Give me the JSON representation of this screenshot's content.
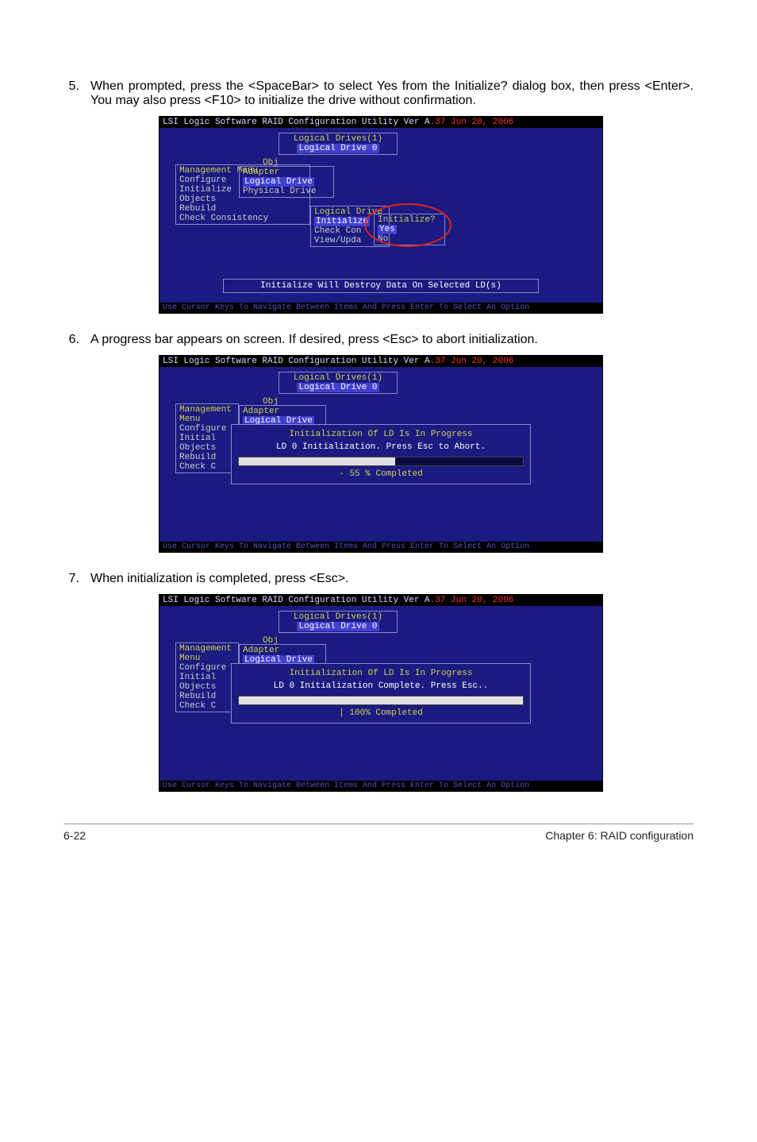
{
  "steps": {
    "s5": {
      "num": "5.",
      "text": "When prompted, press the <SpaceBar> to select Yes from the Initialize? dialog box, then press <Enter>. You may also press <F10> to initialize the drive without confirmation."
    },
    "s6": {
      "num": "6.",
      "text": "A progress bar appears on screen. If desired, press <Esc> to abort initialization."
    },
    "s7": {
      "num": "7.",
      "text": "When initialization is completed, press <Esc>."
    }
  },
  "bios": {
    "title_prefix": "LSI Logic Software RAID Configuration Utility Ver A",
    "title_suffix": ".37 Jun 20, 2006",
    "footer_hint": "Use Cursor Keys To Navigate Between Items And Press Enter To Select An Option",
    "logical_drives_header": "Logical Drives(1)",
    "logical_drive_0": "Logical Drive 0",
    "obj": "Obj",
    "management_menu": "Management Menu",
    "adapter": "Adapter",
    "configure": "Configure",
    "initialize": "Initialize",
    "objects": "Objects",
    "rebuild": "Rebuild",
    "check_consistency": "Check Consistency",
    "initial_short": "Initial",
    "check_c_short": "Check C",
    "logical_drive_label": "Logical Drive",
    "physical_drive_label": "Physical Drive",
    "ld_menu_initialize": "Initialize",
    "ld_menu_check": "Check Con",
    "ld_menu_view": "View/Upda",
    "init_prompt_title": "Initialize?",
    "yes": "Yes",
    "no": "No",
    "warn_msg": "Initialize Will Destroy Data On Selected LD(s)"
  },
  "progress": {
    "header": "Initialization Of LD Is In Progress",
    "msg_running": "LD 0 Initialization. Press Esc to Abort.",
    "pct_running": "- 55 % Completed",
    "msg_done": "LD 0 Initialization Complete. Press Esc..",
    "pct_done": "| 100% Completed",
    "fill_running": 55,
    "fill_done": 100
  },
  "page_footer": {
    "left": "6-22",
    "right": "Chapter 6: RAID configuration"
  }
}
